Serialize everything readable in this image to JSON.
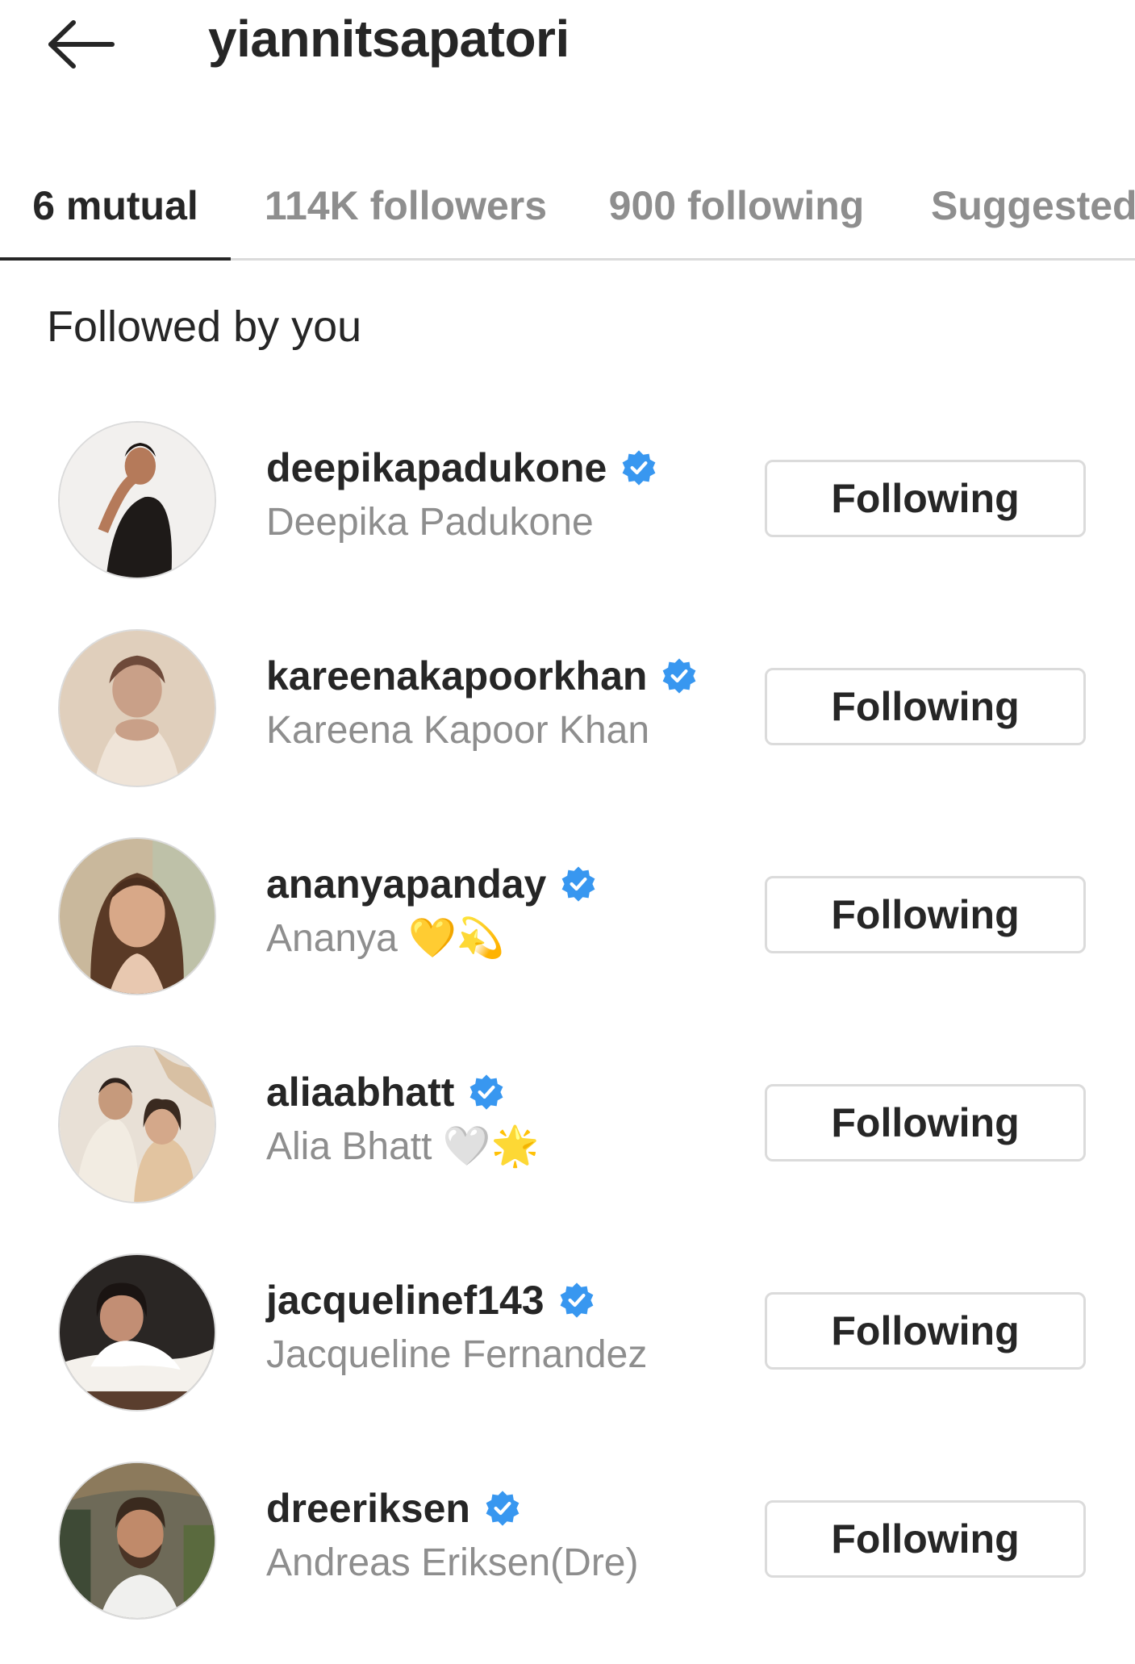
{
  "header": {
    "title": "yiannitsapatori",
    "back_icon": "arrow-left-icon"
  },
  "tabs": [
    {
      "label": "6 mutual",
      "active": true
    },
    {
      "label": "114K followers",
      "active": false
    },
    {
      "label": "900 following",
      "active": false
    },
    {
      "label": "Suggested",
      "active": false
    }
  ],
  "section": {
    "title": "Followed by you"
  },
  "colors": {
    "verified_blue": "#3897f0",
    "text_primary": "#262626",
    "text_secondary": "#8e8e8e",
    "border": "#dbdbdb"
  },
  "accounts": [
    {
      "username": "deepikapadukone",
      "full_name": "Deepika Padukone",
      "verified": true,
      "button": "Following"
    },
    {
      "username": "kareenakapoorkhan",
      "full_name": "Kareena Kapoor Khan",
      "verified": true,
      "button": "Following"
    },
    {
      "username": "ananyapanday",
      "full_name": "Ananya 💛💫",
      "verified": true,
      "button": "Following"
    },
    {
      "username": "aliaabhatt",
      "full_name": "Alia Bhatt 🤍🌟",
      "verified": true,
      "button": "Following"
    },
    {
      "username": "jacquelinef143",
      "full_name": "Jacqueline Fernandez",
      "verified": true,
      "button": "Following"
    },
    {
      "username": "dreeriksen",
      "full_name": "Andreas Eriksen(Dre)",
      "verified": true,
      "button": "Following"
    }
  ]
}
